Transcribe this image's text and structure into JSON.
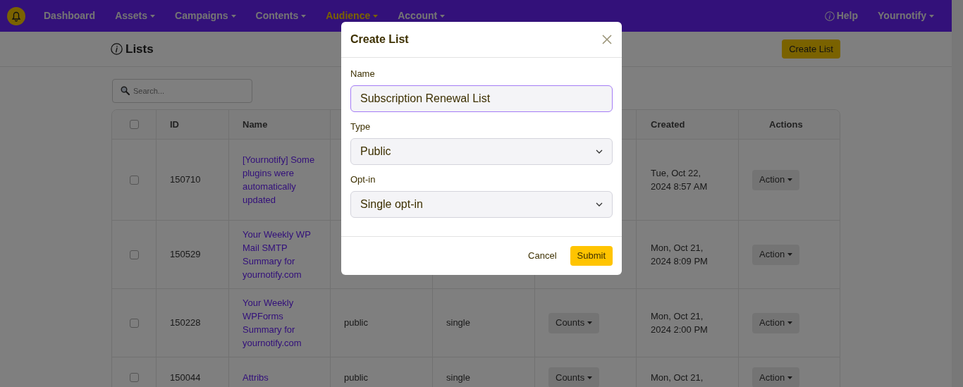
{
  "nav": {
    "items": [
      {
        "label": "Dashboard",
        "selected": false,
        "dropdown": false
      },
      {
        "label": "Assets",
        "selected": false,
        "dropdown": true
      },
      {
        "label": "Campaigns",
        "selected": false,
        "dropdown": true
      },
      {
        "label": "Contents",
        "selected": false,
        "dropdown": true
      },
      {
        "label": "Audience",
        "selected": true,
        "dropdown": true
      },
      {
        "label": "Account",
        "selected": false,
        "dropdown": true
      }
    ],
    "help": "Help",
    "user": "Yournotify"
  },
  "page": {
    "title": "Lists",
    "create_button": "Create List"
  },
  "search": {
    "placeholder": "Search..."
  },
  "table": {
    "select_all_checked": false,
    "columns": {
      "id": "ID",
      "name": "Name",
      "created": "Created",
      "actions": "Actions"
    },
    "rows": [
      {
        "checked": false,
        "id": "150710",
        "name": "[Yournotify] Some plugins were automatically updated",
        "created": "Tue, Oct 22, 2024 8:57 AM",
        "action": "Action"
      },
      {
        "checked": false,
        "id": "150529",
        "name": "Your Weekly WP Mail SMTP Summary for yournotify.com",
        "created": "Mon, Oct 21, 2024 8:09 PM",
        "action": "Action"
      },
      {
        "checked": false,
        "id": "150228",
        "name": "Your Weekly WPForms Summary for yournotify.com",
        "type": "public",
        "optin": "single",
        "counts": "Counts",
        "created": "Mon, Oct 21, 2024 2:00 PM",
        "action": "Action"
      },
      {
        "checked": false,
        "id": "150044",
        "name": "Attribs",
        "type": "public",
        "optin": "single",
        "counts": "Counts",
        "created": "Mon, Oct 21,",
        "action": "Action"
      }
    ]
  },
  "modal": {
    "title": "Create List",
    "fields": [
      {
        "kind": "text",
        "label": "Name",
        "value": "Subscription Renewal List",
        "focused": true
      },
      {
        "kind": "select",
        "label": "Type",
        "value": "Public",
        "focused": false
      },
      {
        "kind": "select",
        "label": "Opt-in",
        "value": "Single opt-in",
        "focused": false
      }
    ],
    "cancel": "Cancel",
    "submit": "Submit"
  }
}
